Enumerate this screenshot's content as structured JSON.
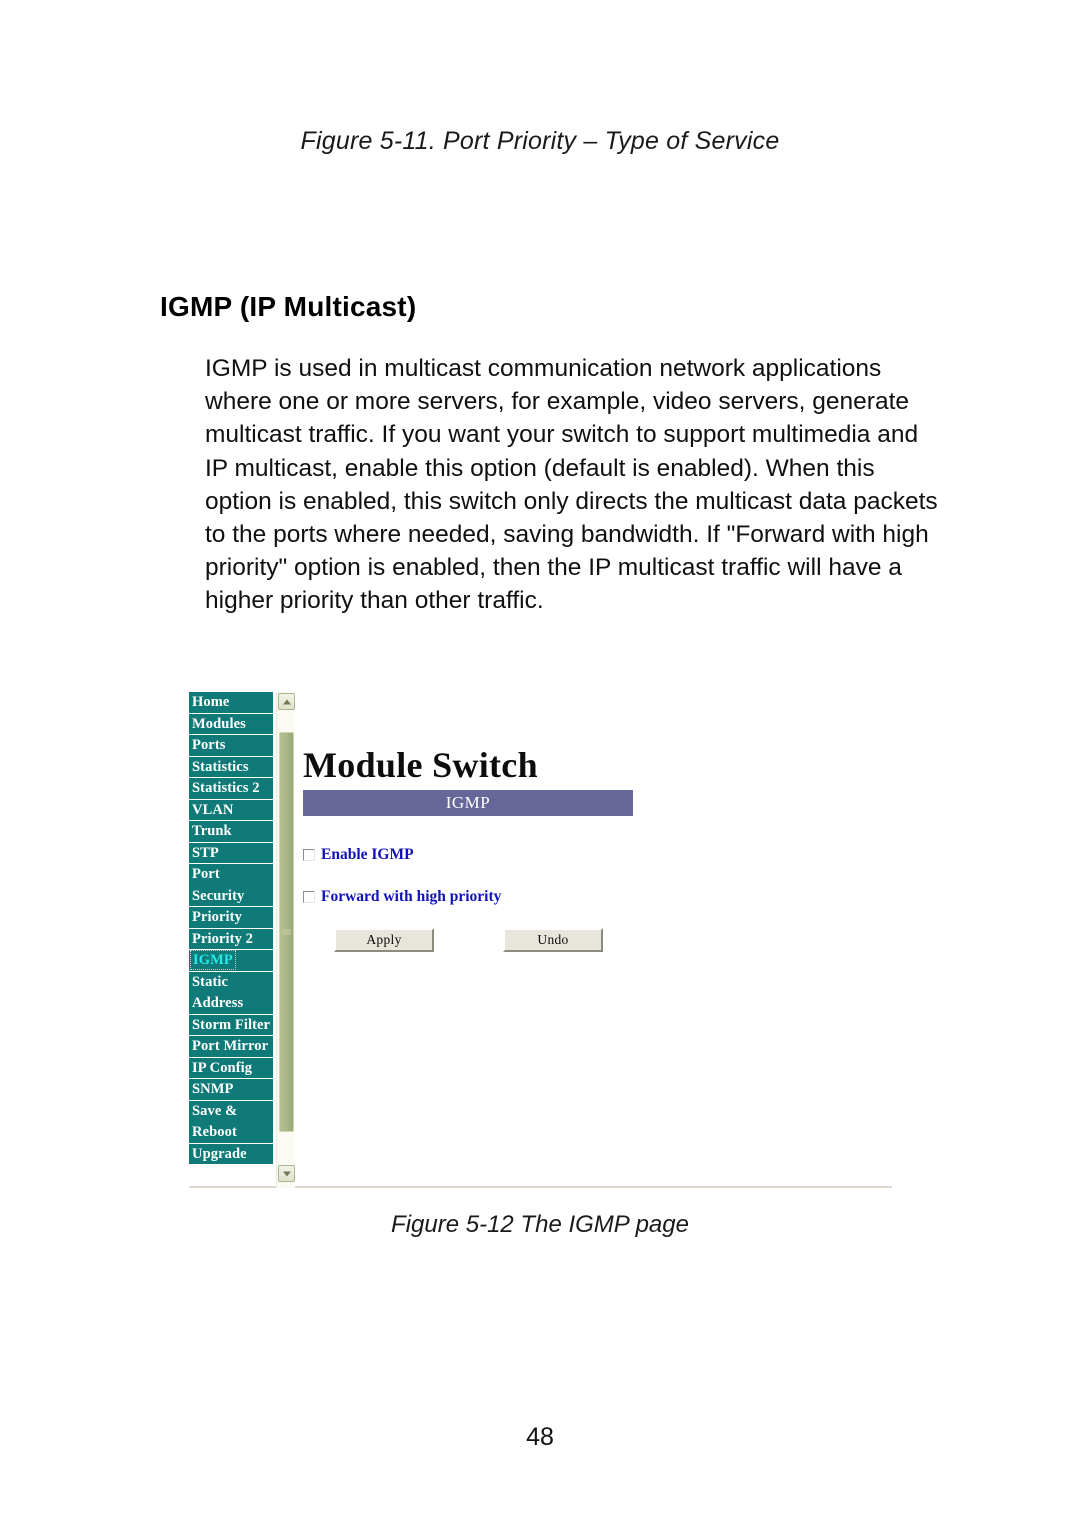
{
  "document": {
    "figure_caption_top": "Figure 5-11. Port Priority – Type of Service",
    "section_heading": "IGMP (IP Multicast)",
    "paragraph": "IGMP is used in multicast communication network applications where one or more servers, for example, video servers, generate multicast traffic. If you want your switch to support multimedia and IP multicast, enable this option (default is enabled). When this option is enabled, this switch only directs the multicast data packets to the ports where needed, saving bandwidth. If \"Forward with high priority\" option is enabled, then the IP multicast traffic will have a higher priority than other traffic.",
    "figure_caption_bottom": "Figure 5-12 The IGMP page",
    "page_number": "48"
  },
  "screenshot": {
    "sidebar": {
      "items": [
        {
          "label": "Home",
          "selected": false
        },
        {
          "label": "Modules",
          "selected": false
        },
        {
          "label": "Ports",
          "selected": false
        },
        {
          "label": "Statistics",
          "selected": false
        },
        {
          "label": "Statistics 2",
          "selected": false
        },
        {
          "label": "VLAN",
          "selected": false
        },
        {
          "label": "Trunk",
          "selected": false
        },
        {
          "label": "STP",
          "selected": false
        },
        {
          "label": "Port",
          "selected": false
        },
        {
          "label": "Security",
          "selected": false
        },
        {
          "label": "Priority",
          "selected": false
        },
        {
          "label": "Priority 2",
          "selected": false
        },
        {
          "label": "IGMP",
          "selected": true
        },
        {
          "label": "Static",
          "selected": false
        },
        {
          "label": "Address",
          "selected": false
        },
        {
          "label": "Storm Filter",
          "selected": false
        },
        {
          "label": "Port Mirror",
          "selected": false
        },
        {
          "label": "IP Config",
          "selected": false
        },
        {
          "label": "SNMP",
          "selected": false
        },
        {
          "label": "Save &",
          "selected": false
        },
        {
          "label": "Reboot",
          "selected": false
        },
        {
          "label": "Upgrade",
          "selected": false
        }
      ],
      "background_color": "#0f7a77",
      "selected_text_color": "#25e8e8"
    },
    "scrollbar": {
      "up_arrow": "scroll-up-arrow",
      "down_arrow": "scroll-down-arrow",
      "thumb_color": "#a8b585"
    },
    "content": {
      "title": "Module Switch",
      "banner_label": "IGMP",
      "banner_color": "#666699",
      "checkboxes": [
        {
          "label": "Enable IGMP",
          "checked": false
        },
        {
          "label": "Forward with high priority",
          "checked": false
        }
      ],
      "buttons": [
        {
          "label": "Apply"
        },
        {
          "label": "Undo"
        }
      ],
      "label_color": "#1111bb"
    }
  }
}
